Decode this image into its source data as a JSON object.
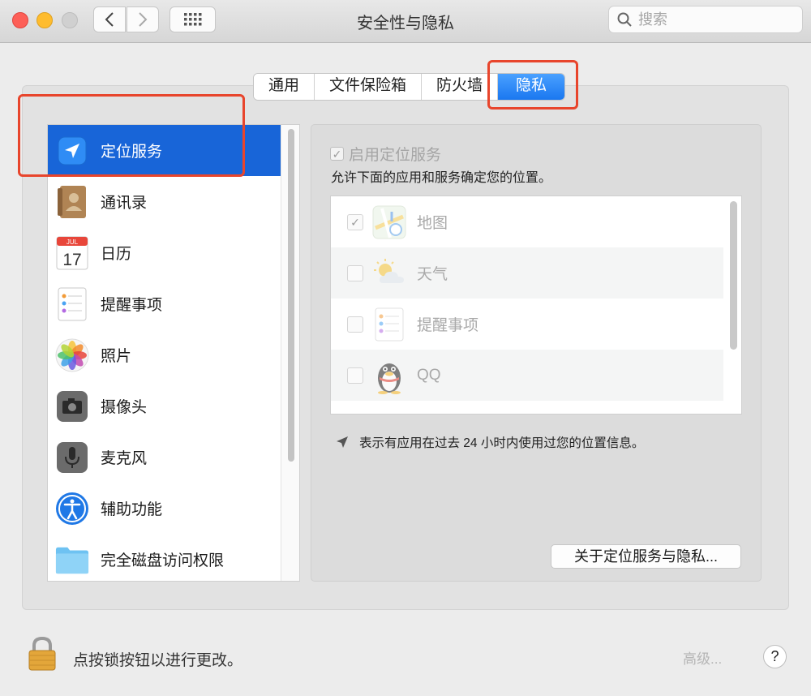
{
  "window": {
    "title": "安全性与隐私",
    "search_placeholder": "搜索"
  },
  "tabs": [
    "通用",
    "文件保险箱",
    "防火墙",
    "隐私"
  ],
  "active_tab": "隐私",
  "sidebar": {
    "items": [
      {
        "label": "定位服务",
        "icon": "location-arrow-icon",
        "selected": true
      },
      {
        "label": "通讯录",
        "icon": "contacts-book-icon",
        "selected": false
      },
      {
        "label": "日历",
        "icon": "calendar-icon",
        "calendar_month": "JUL",
        "calendar_day": "17",
        "selected": false
      },
      {
        "label": "提醒事项",
        "icon": "reminders-icon",
        "selected": false
      },
      {
        "label": "照片",
        "icon": "photos-icon",
        "selected": false
      },
      {
        "label": "摄像头",
        "icon": "camera-icon",
        "selected": false
      },
      {
        "label": "麦克风",
        "icon": "microphone-icon",
        "selected": false
      },
      {
        "label": "辅助功能",
        "icon": "accessibility-icon",
        "selected": false
      },
      {
        "label": "完全磁盘访问权限",
        "icon": "folder-icon",
        "selected": false
      }
    ]
  },
  "location": {
    "enable_label": "启用定位服务",
    "enable_checked": true,
    "description": "允许下面的应用和服务确定您的位置。",
    "apps": [
      {
        "label": "地图",
        "icon": "maps-icon",
        "checked": true
      },
      {
        "label": "天气",
        "icon": "weather-icon",
        "checked": false
      },
      {
        "label": "提醒事项",
        "icon": "reminders-icon",
        "checked": false
      },
      {
        "label": "QQ",
        "icon": "qq-penguin-icon",
        "checked": false
      }
    ],
    "note": "表示有应用在过去 24 小时内使用过您的位置信息。",
    "about_button": "关于定位服务与隐私..."
  },
  "footer": {
    "lock_text": "点按锁按钮以进行更改。",
    "advanced_button": "高级...",
    "help_label": "?"
  },
  "colors": {
    "selection": "#1865d8",
    "tab_active": "#1a77f0",
    "annotation": "#e8452c"
  }
}
